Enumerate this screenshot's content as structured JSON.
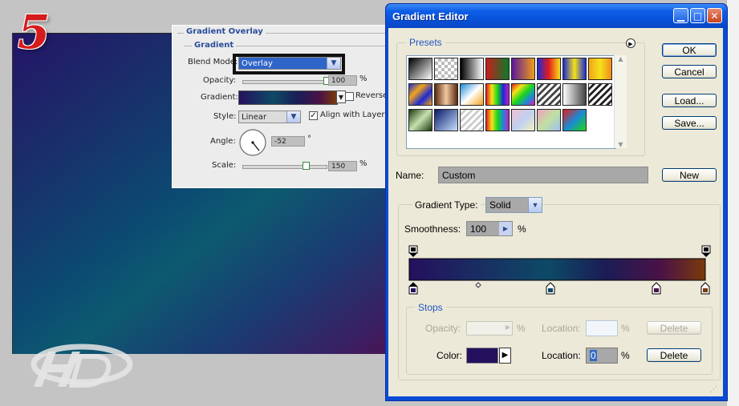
{
  "step_number": "5",
  "layer_style": {
    "section_title": "Gradient Overlay",
    "group_title": "Gradient",
    "blend_mode_label": "Blend Mode:",
    "blend_mode_value": "Overlay",
    "opacity_label": "Opacity:",
    "opacity_value": "100",
    "percent": "%",
    "gradient_label": "Gradient:",
    "reverse_label": "Reverse",
    "style_label": "Style:",
    "style_value": "Linear",
    "align_label": "Align with Layer",
    "angle_label": "Angle:",
    "angle_value": "-52",
    "degree": "°",
    "scale_label": "Scale:",
    "scale_value": "150",
    "opacity_fraction": 1.0,
    "scale_fraction": 0.75
  },
  "editor": {
    "title": "Gradient Editor",
    "presets_label": "Presets",
    "ok": "OK",
    "cancel": "Cancel",
    "load": "Load...",
    "save": "Save...",
    "name_label": "Name:",
    "name_value": "Custom",
    "new_label": "New",
    "gradient_type_label": "Gradient Type:",
    "gradient_type_value": "Solid",
    "smoothness_label": "Smoothness:",
    "smoothness_value": "100",
    "percent": "%",
    "stops_label": "Stops",
    "stop_opacity_label": "Opacity:",
    "stop_location_label": "Location:",
    "delete_label": "Delete",
    "color_label": "Color:",
    "color_location_value": "0",
    "selected_color": "#25105e",
    "gradient_colors": [
      "#25105e",
      "#0d4a66",
      "#1a1d55",
      "#4a1247",
      "#7a3a0a"
    ]
  }
}
